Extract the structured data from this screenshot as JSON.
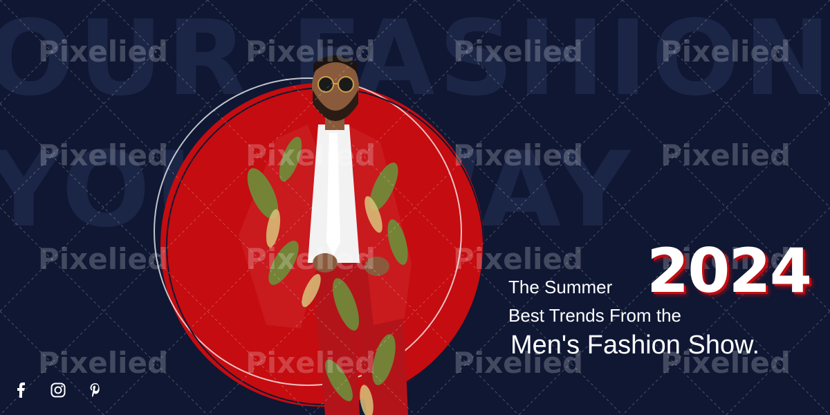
{
  "background": {
    "line1": "OUR FASHION",
    "line2": "YOUR WAY",
    "color": "#0f1733"
  },
  "headline": {
    "summer": "The Summer",
    "year": "2024",
    "trends": "Best Trends From the",
    "show": "Men's Fashion Show."
  },
  "accent_color": "#c50c10",
  "social": [
    {
      "icon": "facebook-icon"
    },
    {
      "icon": "instagram-icon"
    },
    {
      "icon": "pinterest-icon"
    }
  ],
  "watermark": "Pixelied"
}
